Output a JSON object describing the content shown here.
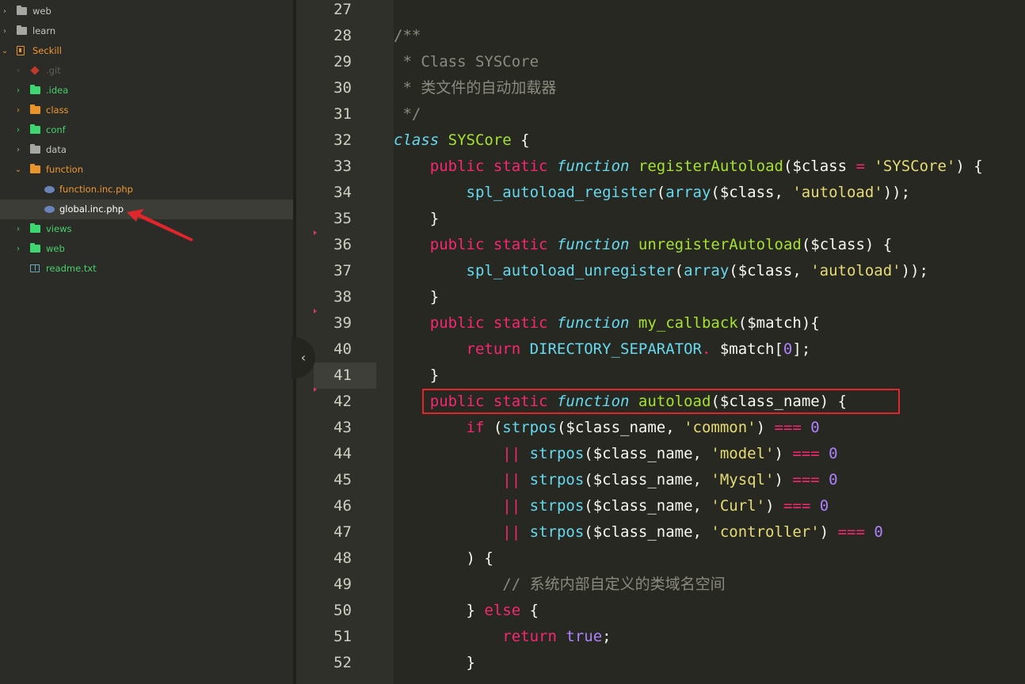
{
  "sidebar": {
    "rows": [
      {
        "name": "folder-web-top",
        "label": "web"
      },
      {
        "name": "folder-learn",
        "label": "learn"
      },
      {
        "name": "project-seckill",
        "label": "Seckill"
      },
      {
        "name": "folder-git",
        "label": ".git"
      },
      {
        "name": "folder-idea",
        "label": ".idea"
      },
      {
        "name": "folder-class",
        "label": "class"
      },
      {
        "name": "folder-conf",
        "label": "conf"
      },
      {
        "name": "folder-data",
        "label": "data"
      },
      {
        "name": "folder-function",
        "label": "function"
      },
      {
        "name": "file-function-inc",
        "label": "function.inc.php"
      },
      {
        "name": "file-global-inc",
        "label": "global.inc.php"
      },
      {
        "name": "folder-views",
        "label": "views"
      },
      {
        "name": "folder-web",
        "label": "web"
      },
      {
        "name": "file-readme",
        "label": "readme.txt"
      }
    ],
    "selected": "global.inc.php"
  },
  "editor": {
    "line_numbers": [
      "27",
      "28",
      "29",
      "30",
      "31",
      "32",
      "33",
      "34",
      "35",
      "36",
      "37",
      "38",
      "39",
      "40",
      "41",
      "42",
      "43",
      "44",
      "45",
      "46",
      "47",
      "48",
      "49",
      "50",
      "51",
      "52"
    ],
    "current_line": "41",
    "highlighted_line": "42",
    "lines": [
      [],
      [
        {
          "t": "/**",
          "c": "cm"
        }
      ],
      [
        {
          "t": " * Class SYSCore",
          "c": "cm"
        }
      ],
      [
        {
          "t": " * 类文件的自动加载器",
          "c": "cm"
        }
      ],
      [
        {
          "t": " */",
          "c": "cm"
        }
      ],
      [
        {
          "t": "class",
          "c": "st"
        },
        {
          "t": " "
        },
        {
          "t": "SYSCore",
          "c": "fn"
        },
        {
          "t": " {"
        }
      ],
      [
        {
          "t": "    "
        },
        {
          "t": "public",
          "c": "kw"
        },
        {
          "t": " "
        },
        {
          "t": "static",
          "c": "kw"
        },
        {
          "t": " "
        },
        {
          "t": "function",
          "c": "st"
        },
        {
          "t": " "
        },
        {
          "t": "registerAutoload",
          "c": "fn"
        },
        {
          "t": "($class "
        },
        {
          "t": "=",
          "c": "kw"
        },
        {
          "t": " "
        },
        {
          "t": "'SYSCore'",
          "c": "str"
        },
        {
          "t": ") {"
        }
      ],
      [
        {
          "t": "        "
        },
        {
          "t": "spl_autoload_register",
          "c": "bi"
        },
        {
          "t": "("
        },
        {
          "t": "array",
          "c": "bi"
        },
        {
          "t": "($class, "
        },
        {
          "t": "'autoload'",
          "c": "str"
        },
        {
          "t": "));"
        }
      ],
      [
        {
          "t": "    }"
        }
      ],
      [
        {
          "t": "    "
        },
        {
          "t": "public",
          "c": "kw"
        },
        {
          "t": " "
        },
        {
          "t": "static",
          "c": "kw"
        },
        {
          "t": " "
        },
        {
          "t": "function",
          "c": "st"
        },
        {
          "t": " "
        },
        {
          "t": "unregisterAutoload",
          "c": "fn"
        },
        {
          "t": "($class) {"
        }
      ],
      [
        {
          "t": "        "
        },
        {
          "t": "spl_autoload_unregister",
          "c": "bi"
        },
        {
          "t": "("
        },
        {
          "t": "array",
          "c": "bi"
        },
        {
          "t": "($class, "
        },
        {
          "t": "'autoload'",
          "c": "str"
        },
        {
          "t": "));"
        }
      ],
      [
        {
          "t": "    }"
        }
      ],
      [
        {
          "t": "    "
        },
        {
          "t": "public",
          "c": "kw"
        },
        {
          "t": " "
        },
        {
          "t": "static",
          "c": "kw"
        },
        {
          "t": " "
        },
        {
          "t": "function",
          "c": "st"
        },
        {
          "t": " "
        },
        {
          "t": "my_callback",
          "c": "fn"
        },
        {
          "t": "($match){"
        }
      ],
      [
        {
          "t": "        "
        },
        {
          "t": "return",
          "c": "kw"
        },
        {
          "t": " "
        },
        {
          "t": "DIRECTORY_SEPARATOR",
          "c": "bi"
        },
        {
          "t": ".",
          "c": "kw"
        },
        {
          "t": " $match["
        },
        {
          "t": "0",
          "c": "num"
        },
        {
          "t": "];"
        }
      ],
      [
        {
          "t": "    }"
        }
      ],
      [
        {
          "t": "    "
        },
        {
          "t": "public",
          "c": "kw"
        },
        {
          "t": " "
        },
        {
          "t": "static",
          "c": "kw"
        },
        {
          "t": " "
        },
        {
          "t": "function",
          "c": "st"
        },
        {
          "t": " "
        },
        {
          "t": "autoload",
          "c": "fn"
        },
        {
          "t": "($class_name) {"
        }
      ],
      [
        {
          "t": "        "
        },
        {
          "t": "if",
          "c": "kw"
        },
        {
          "t": " ("
        },
        {
          "t": "strpos",
          "c": "bi"
        },
        {
          "t": "($class_name, "
        },
        {
          "t": "'common'",
          "c": "str"
        },
        {
          "t": ") "
        },
        {
          "t": "===",
          "c": "kw"
        },
        {
          "t": " "
        },
        {
          "t": "0",
          "c": "num"
        }
      ],
      [
        {
          "t": "            "
        },
        {
          "t": "||",
          "c": "kw"
        },
        {
          "t": " "
        },
        {
          "t": "strpos",
          "c": "bi"
        },
        {
          "t": "($class_name, "
        },
        {
          "t": "'model'",
          "c": "str"
        },
        {
          "t": ") "
        },
        {
          "t": "===",
          "c": "kw"
        },
        {
          "t": " "
        },
        {
          "t": "0",
          "c": "num"
        }
      ],
      [
        {
          "t": "            "
        },
        {
          "t": "||",
          "c": "kw"
        },
        {
          "t": " "
        },
        {
          "t": "strpos",
          "c": "bi"
        },
        {
          "t": "($class_name, "
        },
        {
          "t": "'Mysql'",
          "c": "str"
        },
        {
          "t": ") "
        },
        {
          "t": "===",
          "c": "kw"
        },
        {
          "t": " "
        },
        {
          "t": "0",
          "c": "num"
        }
      ],
      [
        {
          "t": "            "
        },
        {
          "t": "||",
          "c": "kw"
        },
        {
          "t": " "
        },
        {
          "t": "strpos",
          "c": "bi"
        },
        {
          "t": "($class_name, "
        },
        {
          "t": "'Curl'",
          "c": "str"
        },
        {
          "t": ") "
        },
        {
          "t": "===",
          "c": "kw"
        },
        {
          "t": " "
        },
        {
          "t": "0",
          "c": "num"
        }
      ],
      [
        {
          "t": "            "
        },
        {
          "t": "||",
          "c": "kw"
        },
        {
          "t": " "
        },
        {
          "t": "strpos",
          "c": "bi"
        },
        {
          "t": "($class_name, "
        },
        {
          "t": "'controller'",
          "c": "str"
        },
        {
          "t": ") "
        },
        {
          "t": "===",
          "c": "kw"
        },
        {
          "t": " "
        },
        {
          "t": "0",
          "c": "num"
        }
      ],
      [
        {
          "t": "        ) {"
        }
      ],
      [
        {
          "t": "            "
        },
        {
          "t": "// 系统内部自定义的类域名空间",
          "c": "cm"
        }
      ],
      [
        {
          "t": "        } "
        },
        {
          "t": "else",
          "c": "kw"
        },
        {
          "t": " {"
        }
      ],
      [
        {
          "t": "            "
        },
        {
          "t": "return",
          "c": "kw"
        },
        {
          "t": " "
        },
        {
          "t": "true",
          "c": "num"
        },
        {
          "t": ";"
        }
      ],
      [
        {
          "t": "        }"
        }
      ]
    ]
  },
  "colors": {
    "background": "#272822",
    "keyword": "#f92672",
    "storage": "#66d9ef",
    "function_name": "#a6e22e",
    "string": "#e6db74",
    "number": "#ae81ff",
    "comment": "#8a8a7e",
    "annotation": "#e0262a"
  },
  "icons": {
    "collapse": "chevron-left-icon",
    "folder": "folder-icon",
    "php": "php-file-icon",
    "text": "text-file-icon",
    "git": "git-icon",
    "project": "project-book-icon"
  }
}
